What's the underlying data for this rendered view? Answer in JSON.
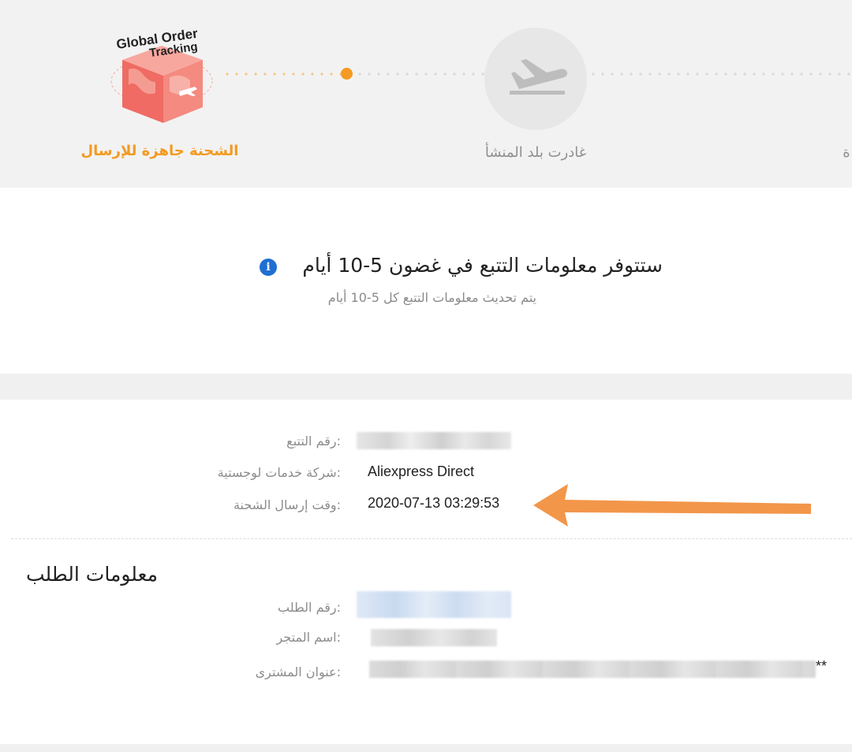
{
  "tracking_progress": {
    "logo_text_line1": "Global Order",
    "logo_text_line2": "Tracking",
    "stages": [
      {
        "label": "الشحنة جاهزة للإرسال",
        "state": "active"
      },
      {
        "label": "غادرت بلد المنشأ",
        "state": "pending"
      },
      {
        "label": "ة",
        "state": "pending"
      }
    ],
    "active_color": "#f39a21"
  },
  "notice": {
    "title": "ستتوفر معلومات التتبع في غضون 5-10 أيام",
    "subtitle": "يتم تحديث معلومات التتبع كل 5-10 أيام",
    "info_icon_glyph": "i"
  },
  "shipment_info": {
    "tracking_number_label": ":رقم التتبع",
    "logistics_company_label": ":شركة خدمات لوجستية",
    "logistics_company_value": "Aliexpress Direct",
    "ship_time_label": ":وقت إرسال الشحنة",
    "ship_time_value": "2020-07-13 03:29:53"
  },
  "order_info": {
    "title": "معلومات الطلب",
    "order_number_label": ":رقم الطلب",
    "store_name_label": ":اسم المتجر",
    "buyer_address_label": ":عنوان المشترى",
    "address_suffix": "**"
  },
  "icons": {
    "plane": "airplane-landing-icon",
    "info": "info-icon",
    "arrow": "arrow-left-icon"
  },
  "colors": {
    "accent_orange": "#f59a23",
    "arrow_orange": "#f2964a",
    "info_blue": "#1f6fd2"
  }
}
